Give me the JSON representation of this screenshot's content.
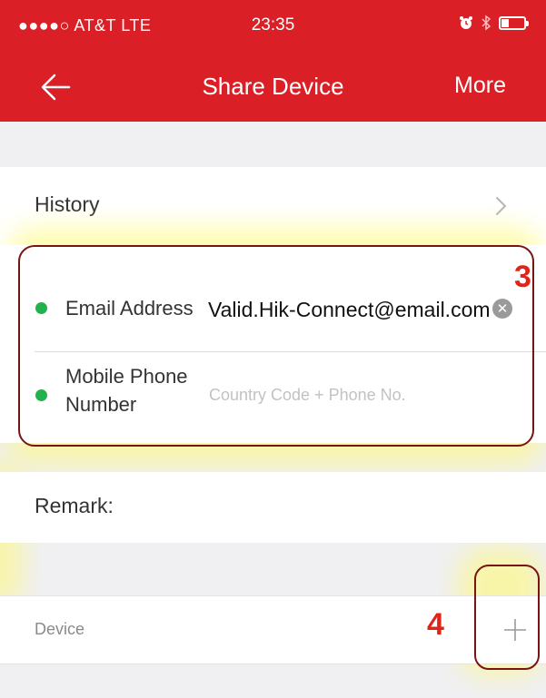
{
  "status_bar": {
    "carrier": "●●●●○ AT&T  LTE",
    "time": "23:35"
  },
  "nav": {
    "title": "Share Device",
    "more_label": "More"
  },
  "history": {
    "label": "History"
  },
  "contact": {
    "email_label": "Email Address",
    "email_value": "Valid.Hik-Connect@email.com",
    "phone_label_line1": "Mobile Phone",
    "phone_label_line2": "Number",
    "phone_placeholder": "Country Code + Phone No.",
    "indicator_color": "#22b14c"
  },
  "remark": {
    "label": "Remark:"
  },
  "device": {
    "label": "Device"
  },
  "annotations": {
    "step3": "3",
    "step4": "4"
  },
  "colors": {
    "brand": "#da1f26",
    "annotation": "#e2231a",
    "highlight": "#fffa6e"
  }
}
